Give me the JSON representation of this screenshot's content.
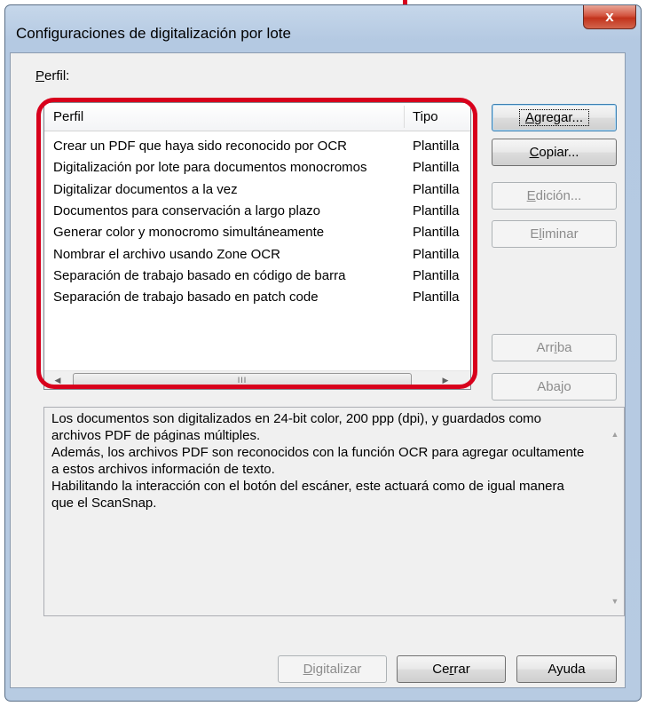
{
  "window": {
    "title": "Configuraciones de digitalización por lote",
    "close_glyph": "x"
  },
  "profile_label": {
    "ul": "P",
    "rest": "erfil:"
  },
  "list": {
    "columns": [
      "Perfil",
      "Tipo"
    ],
    "rows": [
      {
        "name": "Crear un PDF que haya sido reconocido por OCR",
        "type": "Plantilla"
      },
      {
        "name": "Digitalización por lote para documentos monocromos",
        "type": "Plantilla"
      },
      {
        "name": "Digitalizar documentos a la vez",
        "type": "Plantilla"
      },
      {
        "name": "Documentos para conservación a largo plazo",
        "type": "Plantilla"
      },
      {
        "name": "Generar color y monocromo simultáneamente",
        "type": "Plantilla"
      },
      {
        "name": "Nombrar el archivo usando Zone OCR",
        "type": "Plantilla"
      },
      {
        "name": "Separación de trabajo basado en código de barra",
        "type": "Plantilla"
      },
      {
        "name": "Separación de trabajo basado en patch code",
        "type": "Plantilla"
      }
    ],
    "scroll_thumb_grip": "III"
  },
  "buttons": {
    "agregar": {
      "pre": "",
      "ul": "A",
      "post": "gregar..."
    },
    "copiar": {
      "pre": "",
      "ul": "C",
      "post": "opiar..."
    },
    "edicion": {
      "pre": "",
      "ul": "E",
      "post": "dición..."
    },
    "eliminar": {
      "pre": "E",
      "ul": "l",
      "post": "iminar"
    },
    "arriba": {
      "pre": "Arr",
      "ul": "i",
      "post": "ba"
    },
    "abajo": {
      "pre": "Aba",
      "ul": "j",
      "post": "o"
    },
    "digitalizar": {
      "pre": "",
      "ul": "D",
      "post": "igitalizar"
    },
    "cerrar": {
      "pre": "Ce",
      "ul": "r",
      "post": "rar"
    },
    "ayuda": {
      "pre": "Ayuda",
      "ul": "",
      "post": ""
    }
  },
  "description": {
    "lines": [
      "Los documentos son digitalizados en 24-bit color, 200 ppp (dpi), y guardados como archivos PDF de páginas múltiples.",
      "Además, los archivos PDF son reconocidos con la función OCR para agregar ocultamente a estos archivos información de texto.",
      "Habilitando la interacción con el botón del escáner, este actuará como de igual manera que el ScanSnap."
    ]
  },
  "colors": {
    "callout": "#d8001c",
    "close_button": "#c2331c"
  },
  "icons": {
    "close": "close-icon",
    "scroll_left": "arrow-left-icon",
    "scroll_right": "arrow-right-icon",
    "scroll_up": "arrow-up-icon",
    "scroll_down": "arrow-down-icon"
  }
}
